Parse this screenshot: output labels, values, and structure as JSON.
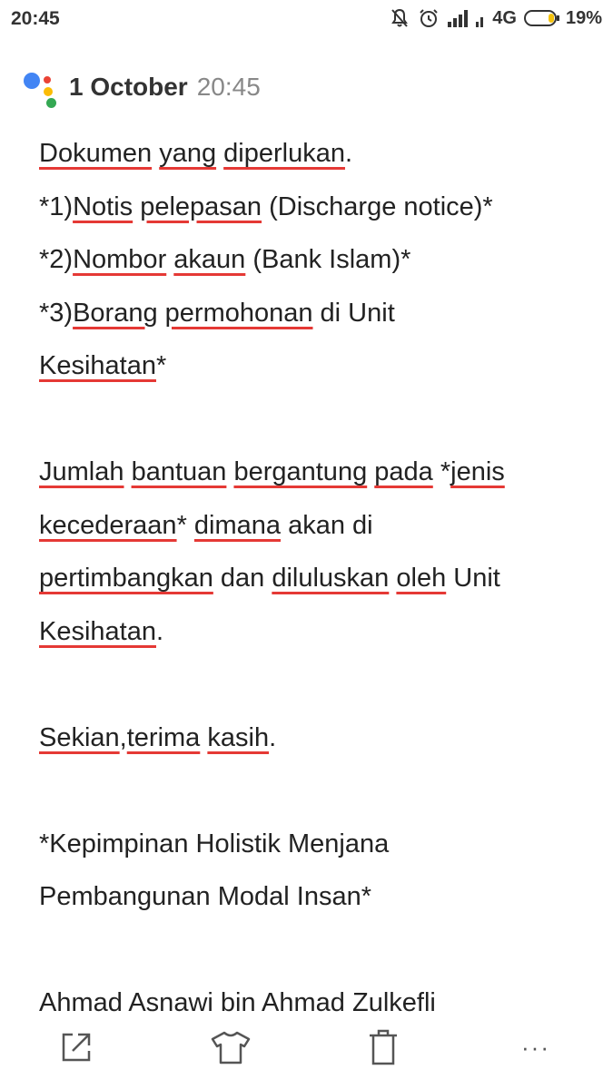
{
  "status_bar": {
    "time": "20:45",
    "network": "4G",
    "battery": "19%"
  },
  "header": {
    "date": "1 October",
    "time": "20:45"
  },
  "message": {
    "line1": [
      "Dokumen",
      " ",
      "yang",
      " ",
      "diperlukan",
      "."
    ],
    "line2": [
      "*1)",
      "Notis",
      " ",
      "pelepasan",
      " (Discharge notice)*"
    ],
    "line3": [
      "*2)",
      "Nombor",
      " ",
      "akaun",
      " (Bank Islam)*"
    ],
    "line4": [
      "*3)",
      "Borang",
      " ",
      "permohonan",
      " di Unit"
    ],
    "line5": [
      "Kesihatan",
      "*"
    ],
    "line6": [
      "Jumlah",
      " ",
      "bantuan",
      " ",
      "bergantung",
      " ",
      "pada",
      " *",
      "jenis"
    ],
    "line7": [
      "kecederaan",
      "* ",
      "dimana",
      " akan di"
    ],
    "line8": [
      "pertimbangkan",
      " dan ",
      "diluluskan",
      " ",
      "oleh",
      " Unit"
    ],
    "line9": [
      "Kesihatan",
      "."
    ],
    "line10": [
      "Sekian",
      ",",
      "terima",
      " ",
      "kasih",
      "."
    ],
    "line11": "*Kepimpinan Holistik Menjana",
    "line12": "Pembangunan Modal Insan*",
    "line13": "Ahmad Asnawi bin Ahmad Zulkefli"
  },
  "toolbar": {
    "share_icon": "share-icon",
    "theme_icon": "shirt-icon",
    "delete_icon": "trash-icon",
    "more_icon": "more-icon",
    "more_label": "···"
  },
  "colors": {
    "spell_underline": "#E53935",
    "text": "#222222",
    "assistant_blue": "#4285F4",
    "assistant_red": "#EA4335",
    "assistant_yellow": "#FBBC05",
    "assistant_green": "#34A853",
    "battery_fill": "#F4C20D"
  }
}
